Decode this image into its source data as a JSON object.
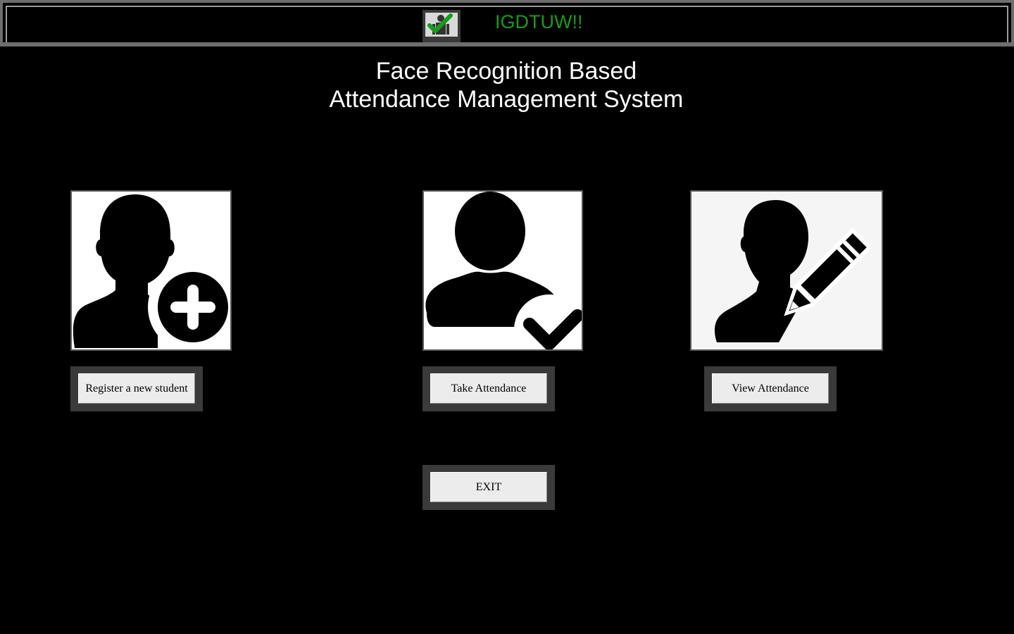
{
  "header": {
    "title": "IGDTUW!!",
    "title_color": "#169c1b",
    "logo_icon": "attendance-check-icon"
  },
  "main": {
    "title_line_1": "Face Recognition Based",
    "title_line_2": "Attendance Management System"
  },
  "actions": {
    "register": {
      "label": "Register a new student",
      "icon": "add-user-icon"
    },
    "take": {
      "label": "Take Attendance",
      "icon": "user-check-icon"
    },
    "view": {
      "label": "View Attendance",
      "icon": "user-edit-icon"
    },
    "exit": {
      "label": "EXIT"
    }
  },
  "colors": {
    "background": "#000000",
    "accent_green": "#169c1b",
    "button_face": "#ececec",
    "button_frame": "#3a3a3a"
  }
}
